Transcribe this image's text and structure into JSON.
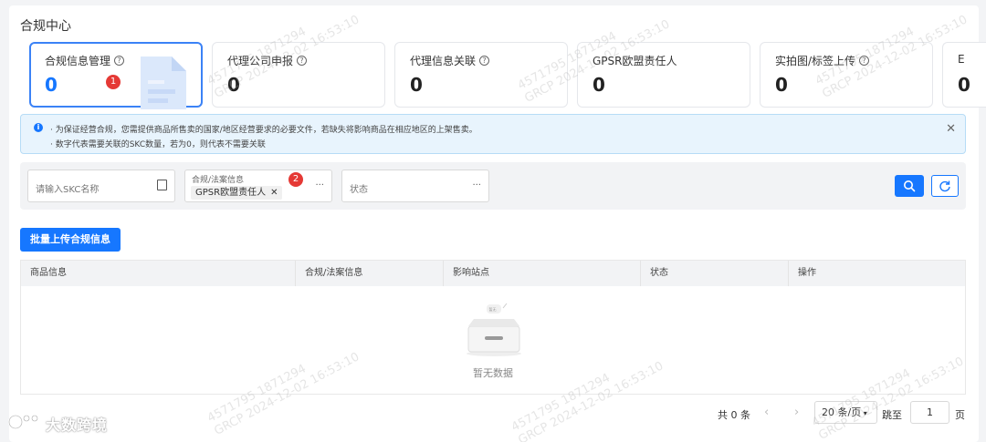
{
  "page": {
    "title": "合规中心"
  },
  "tabs": [
    {
      "label": "合规信息管理",
      "count": "0",
      "badge": "1",
      "help": true,
      "active": true
    },
    {
      "label": "代理公司申报",
      "count": "0",
      "help": true
    },
    {
      "label": "代理信息关联",
      "count": "0",
      "help": true
    },
    {
      "label": "GPSR欧盟责任人",
      "count": "0",
      "help": false
    },
    {
      "label": "实拍图/标签上传",
      "count": "0",
      "help": true
    },
    {
      "label": "E",
      "count": "0",
      "help": false
    }
  ],
  "notice": {
    "line1": "· 为保证经营合规，您需提供商品所售卖的国家/地区经营要求的必要文件，若缺失将影响商品在相应地区的上架售卖。",
    "line2": "· 数字代表需要关联的SKC数量，若为0，则代表不需要关联"
  },
  "filters": {
    "skc_placeholder": "请输入SKC名称",
    "compliance_label": "合规/法案信息",
    "compliance_tag": "GPSR欧盟责任人",
    "compliance_badge": "2",
    "status_placeholder": "状态",
    "more": "···"
  },
  "actions": {
    "bulk_upload": "批量上传合规信息"
  },
  "table": {
    "columns": [
      "商品信息",
      "合规/法案信息",
      "影响站点",
      "状态",
      "操作"
    ],
    "empty_text": "暂无数据",
    "empty_box_label": "暂无"
  },
  "pagination": {
    "total": "共 0 条",
    "prev": "‹",
    "next": "›",
    "page_size": "20 条/页",
    "jump_label": "跳至",
    "jump_value": "1",
    "page_label": "页"
  },
  "watermark": {
    "line1": "4571795 1871294",
    "line2": "GRCP 2024-12-02 16:53:10"
  },
  "brand": {
    "text": "大数跨境"
  },
  "colors": {
    "primary": "#1677ff",
    "badge": "#e53935",
    "notice_bg": "#e8f4fd"
  }
}
